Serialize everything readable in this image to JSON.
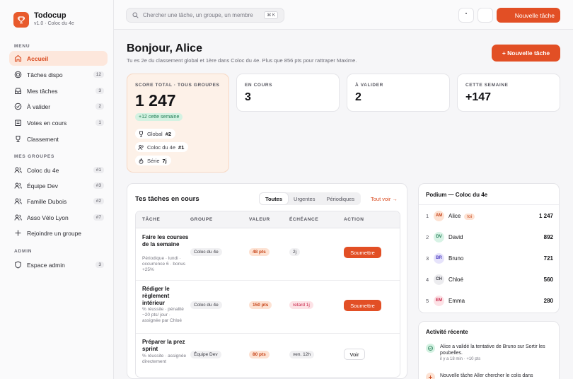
{
  "app": {
    "name": "Todocup",
    "version": "v1.0 · Coloc du 4e"
  },
  "sidebar": {
    "menu_label": "MENU",
    "menu": [
      {
        "label": "Accueil",
        "icon": "home-icon",
        "count": ""
      },
      {
        "label": "Tâches dispo",
        "icon": "target-icon",
        "count": "12"
      },
      {
        "label": "Mes tâches",
        "icon": "inbox-icon",
        "count": "3"
      },
      {
        "label": "À valider",
        "icon": "check-circle-icon",
        "count": "2"
      },
      {
        "label": "Votes en cours",
        "icon": "ballot-icon",
        "count": "1"
      },
      {
        "label": "Classement",
        "icon": "trophy-icon",
        "count": ""
      }
    ],
    "groups_label": "MES GROUPES",
    "groups": [
      {
        "label": "Coloc du 4e",
        "count": "#1"
      },
      {
        "label": "Équipe Dev",
        "count": "#3"
      },
      {
        "label": "Famille Dubois",
        "count": "#2"
      },
      {
        "label": "Asso Vélo Lyon",
        "count": "#7"
      }
    ],
    "join_label": "Rejoindre un groupe",
    "admin_label": "ADMIN",
    "admin_item": {
      "label": "Espace admin",
      "count": "3"
    }
  },
  "topbar": {
    "search_placeholder": "Chercher une tâche, un groupe, un membre",
    "search_shortcut": "⌘ K",
    "new_task": "Nouvelle tâche"
  },
  "header": {
    "greeting": "Bonjour, Alice",
    "subtitle": "Tu es 2e du classement global et 1ère dans Coloc du 4e. Plus que 856 pts pour rattraper Maxime.",
    "new_task": "+ Nouvelle tâche"
  },
  "score": {
    "label": "SCORE TOTAL · TOUS GROUPES",
    "value": "1 247",
    "delta": "+12 cette semaine",
    "rows": [
      {
        "label": "Global",
        "value": "#2"
      },
      {
        "label": "Coloc du 4e",
        "value": "#1"
      },
      {
        "label": "Série",
        "value": "7j"
      }
    ]
  },
  "stats": [
    {
      "label": "EN COURS",
      "value": "3"
    },
    {
      "label": "À VALIDER",
      "value": "2"
    },
    {
      "label": "CETTE SEMAINE",
      "value": "+147"
    }
  ],
  "tasks": {
    "title": "Tes tâches en cours",
    "tabs": [
      "Toutes",
      "Urgentes",
      "Périodiques"
    ],
    "see_all": "Tout voir →",
    "columns": [
      "TÂCHE",
      "GROUPE",
      "VALEUR",
      "ÉCHÉANCE",
      "ACTION"
    ],
    "rows": [
      {
        "name": "Faire les courses de la semaine",
        "meta": "Périodique · lundi · occurrence 6 · bonus +25%",
        "group": "Coloc du 4e",
        "value": "48 pts",
        "due": "2j",
        "late": false,
        "action": "Soumettre"
      },
      {
        "name": "Rédiger le règlement intérieur",
        "meta": "% réussite · pénalité −20 pts/ jour · assignée par Chloé",
        "group": "Coloc du 4e",
        "value": "150 pts",
        "due": "retard 1j",
        "late": true,
        "action": "Soumettre"
      },
      {
        "name": "Préparer la prez sprint",
        "meta": "% réussite · assignée directement",
        "group": "Équipe Dev",
        "value": "80 pts",
        "due": "ven. 12h",
        "late": false,
        "action": "Voir"
      }
    ]
  },
  "podium": {
    "title": "Podium — Coloc du 4e",
    "you_badge": "toi",
    "rows": [
      {
        "rank": "1",
        "initials": "AM",
        "name": "Alice",
        "points": "1 247",
        "bg": "#fde2d3",
        "fg": "#c7461b"
      },
      {
        "rank": "2",
        "initials": "DV",
        "name": "David",
        "points": "892",
        "bg": "#d8f3e6",
        "fg": "#1f7a52"
      },
      {
        "rank": "3",
        "initials": "BR",
        "name": "Bruno",
        "points": "721",
        "bg": "#e6e3fb",
        "fg": "#4b3cc0"
      },
      {
        "rank": "4",
        "initials": "CH",
        "name": "Chloé",
        "points": "560",
        "bg": "#ececef",
        "fg": "#3a3a42"
      },
      {
        "rank": "5",
        "initials": "EM",
        "name": "Emma",
        "points": "280",
        "bg": "#fde2e6",
        "fg": "#c62347"
      }
    ]
  },
  "activity": {
    "title": "Activité récente",
    "items": [
      {
        "text": "Alice a validé la tentative de Bruno sur Sortir les poubelles.",
        "time": "il y a 18 min · +10 pts"
      },
      {
        "text": "Nouvelle tâche Aller chercher le colis dans",
        "time": ""
      }
    ]
  }
}
